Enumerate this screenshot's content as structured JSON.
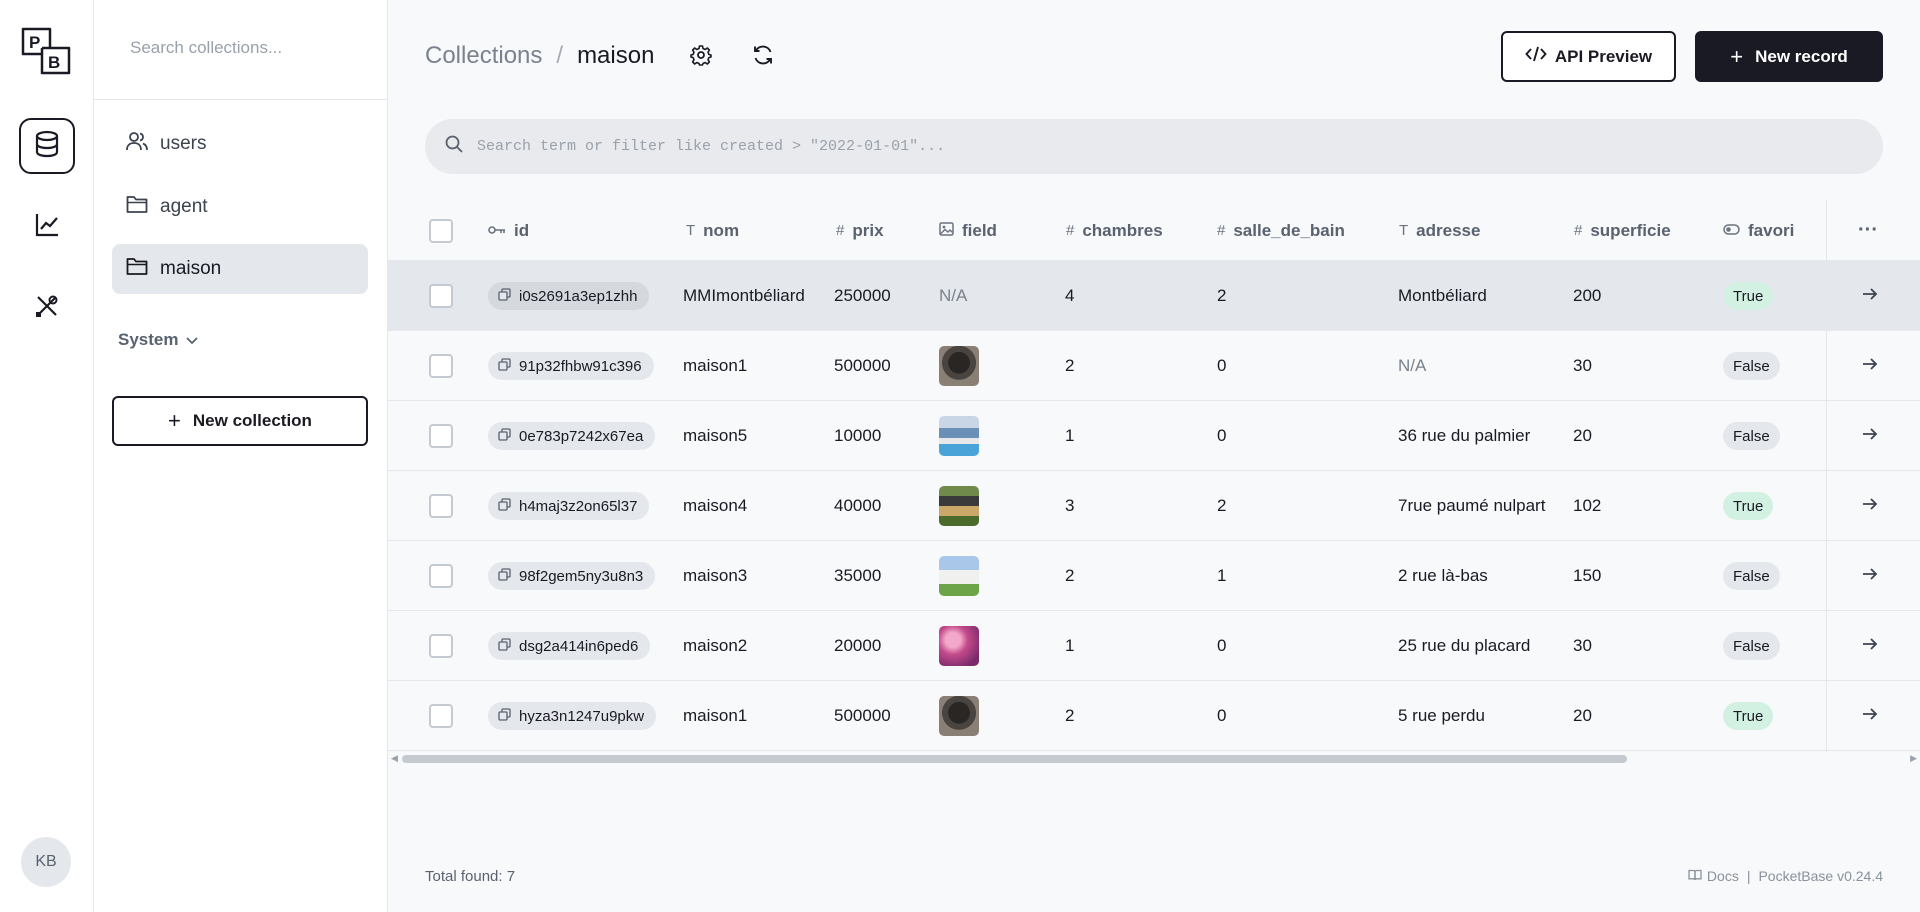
{
  "app": {
    "logo_text": "PB",
    "avatar_initials": "KB"
  },
  "sidebar": {
    "search_placeholder": "Search collections...",
    "collections": [
      {
        "label": "users",
        "icon": "users-icon"
      },
      {
        "label": "agent",
        "icon": "folder-icon"
      },
      {
        "label": "maison",
        "icon": "folder-icon",
        "active": true
      }
    ],
    "system_label": "System",
    "new_collection_label": "New collection"
  },
  "header": {
    "breadcrumb_root": "Collections",
    "breadcrumb_sep": "/",
    "breadcrumb_current": "maison",
    "api_preview_label": "API Preview",
    "new_record_label": "New record"
  },
  "search": {
    "placeholder": "Search term or filter like created > \"2022-01-01\"..."
  },
  "table": {
    "columns": [
      {
        "key": "id",
        "label": "id",
        "icon": "key-icon"
      },
      {
        "key": "nom",
        "label": "nom",
        "icon": "text-icon"
      },
      {
        "key": "prix",
        "label": "prix",
        "icon": "hash-icon"
      },
      {
        "key": "field",
        "label": "field",
        "icon": "image-icon"
      },
      {
        "key": "chambres",
        "label": "chambres",
        "icon": "hash-icon"
      },
      {
        "key": "salle_de_bain",
        "label": "salle_de_bain",
        "icon": "hash-icon"
      },
      {
        "key": "adresse",
        "label": "adresse",
        "icon": "text-icon"
      },
      {
        "key": "superficie",
        "label": "superficie",
        "icon": "hash-icon"
      },
      {
        "key": "favori",
        "label": "favori",
        "icon": "toggle-icon"
      }
    ],
    "more_label": "···",
    "rows": [
      {
        "id": "i0s2691a3ep1zhh",
        "nom": "MMImontbéliard",
        "prix": "250000",
        "field": "N/A",
        "chambres": "4",
        "salle_de_bain": "2",
        "adresse": "Montbéliard",
        "superficie": "200",
        "favori": "True"
      },
      {
        "id": "91p32fhbw91c396",
        "nom": "maison1",
        "prix": "500000",
        "field": "cat-photo",
        "chambres": "2",
        "salle_de_bain": "0",
        "adresse": "N/A",
        "superficie": "30",
        "favori": "False"
      },
      {
        "id": "0e783p7242x67ea",
        "nom": "maison5",
        "prix": "10000",
        "field": "pool-photo",
        "chambres": "1",
        "salle_de_bain": "0",
        "adresse": "36 rue du palmier",
        "superficie": "20",
        "favori": "False"
      },
      {
        "id": "h4maj3z2on65l37",
        "nom": "maison4",
        "prix": "40000",
        "field": "house-photo",
        "chambres": "3",
        "salle_de_bain": "2",
        "adresse": "7rue paumé nulpart",
        "superficie": "102",
        "favori": "True"
      },
      {
        "id": "98f2gem5ny3u8n3",
        "nom": "maison3",
        "prix": "35000",
        "field": "white-house-photo",
        "chambres": "2",
        "salle_de_bain": "1",
        "adresse": "2 rue là-bas",
        "superficie": "150",
        "favori": "False"
      },
      {
        "id": "dsg2a414in6ped6",
        "nom": "maison2",
        "prix": "20000",
        "field": "pink-abstract-photo",
        "chambres": "1",
        "salle_de_bain": "0",
        "adresse": "25 rue du placard",
        "superficie": "30",
        "favori": "False"
      },
      {
        "id": "hyza3n1247u9pkw",
        "nom": "maison1",
        "prix": "500000",
        "field": "cat-photo",
        "chambres": "2",
        "salle_de_bain": "0",
        "adresse": "5 rue perdu",
        "superficie": "20",
        "favori": "True"
      }
    ]
  },
  "footer": {
    "total_label": "Total found:",
    "total_count": "7",
    "docs_label": "Docs",
    "sep": "|",
    "version_label": "PocketBase v0.24.4"
  },
  "colors": {
    "accent": "#1a1a24",
    "true_badge": "#d3f1e3",
    "false_badge": "#e4e7eb",
    "row_highlight": "#e4e7eb"
  }
}
